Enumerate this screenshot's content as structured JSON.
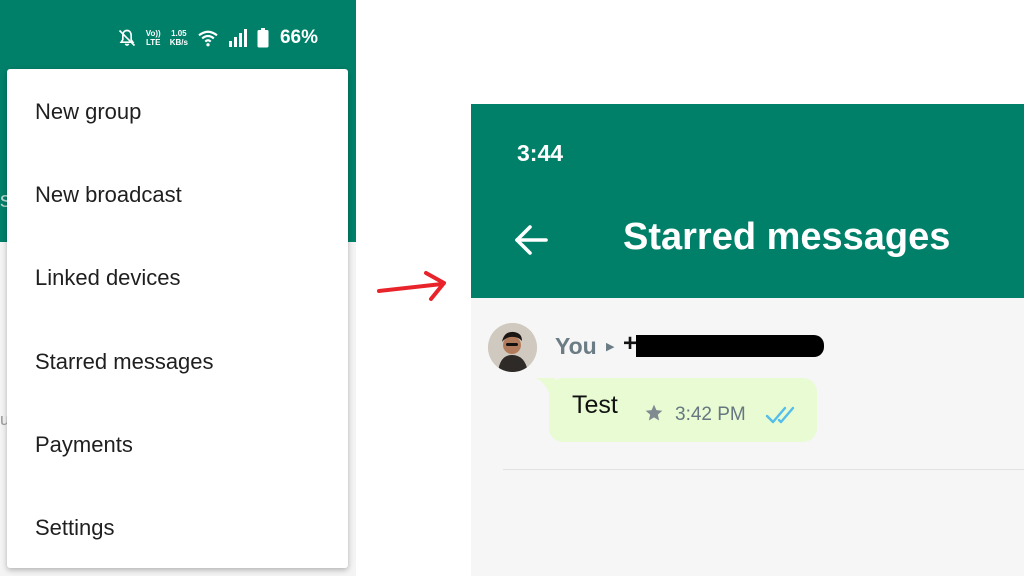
{
  "status_bar": {
    "volte_top": "Vo))",
    "volte_bottom": "LTE",
    "speed_value": "1.05",
    "speed_unit": "KB/s",
    "battery": "66%",
    "icons": [
      "mute-bell-icon",
      "volte-icon",
      "wifi-icon",
      "signal-icon",
      "battery-icon"
    ]
  },
  "left_edge": {
    "char_s": "s",
    "char_u": "u"
  },
  "menu": {
    "items": [
      {
        "label": "New group"
      },
      {
        "label": "New broadcast"
      },
      {
        "label": "Linked devices"
      },
      {
        "label": "Starred messages"
      },
      {
        "label": "Payments"
      },
      {
        "label": "Settings"
      }
    ]
  },
  "starred_screen": {
    "clock": "3:44",
    "title": "Starred messages",
    "message": {
      "sender": "You",
      "recipient_prefix": "+",
      "text": "Test",
      "time": "3:42 PM",
      "starred": true,
      "status": "read"
    }
  },
  "colors": {
    "header_green": "#008069",
    "bubble_green": "#e8fbd2",
    "read_ticks": "#53bdeb",
    "arrow_red": "#e8232a"
  }
}
